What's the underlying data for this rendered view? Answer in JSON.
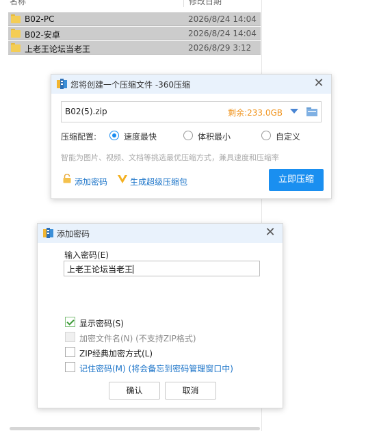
{
  "explorer": {
    "files": [
      {
        "name": "B02-PC",
        "date": "2026/8/24 14:04"
      },
      {
        "name": "B02-安卓",
        "date": "2026/8/24 14:04"
      },
      {
        "name": "上老王论坛当老王",
        "date": "2026/8/29 3:12"
      }
    ]
  },
  "compress_dialog": {
    "title": "您将创建一个压缩文件 -360压缩",
    "path": "B02(5).zip",
    "remaining": "剩余:233.0GB",
    "config_label": "压缩配置:",
    "options": [
      "速度最快",
      "体积最小",
      "自定义"
    ],
    "selected_option": "速度最快",
    "hint": "智能为图片、视频、文档等挑选最优压缩方式，兼具速度和压缩率",
    "add_password_link": "添加密码",
    "super_compress_link": "生成超级压缩包",
    "compress_button": "立即压缩",
    "colors": {
      "accent": "#1a8ff0",
      "remaining": "#f0931c",
      "link": "#1a73c8"
    }
  },
  "password_dialog": {
    "title": "添加密码",
    "input_label": "输入密码(E)",
    "password_value": "上老王论坛当老王",
    "checkboxes": [
      {
        "label": "显示密码(S)",
        "checked": true,
        "disabled": false
      },
      {
        "label": "加密文件名(N) (不支持ZIP格式)",
        "checked": false,
        "disabled": true
      },
      {
        "label": "ZIP经典加密方式(L)",
        "checked": false,
        "disabled": false
      },
      {
        "label": "记住密码(M) (将会备忘到密码管理窗口中)",
        "checked": false,
        "disabled": false
      }
    ],
    "ok_button": "确认",
    "cancel_button": "取消"
  }
}
